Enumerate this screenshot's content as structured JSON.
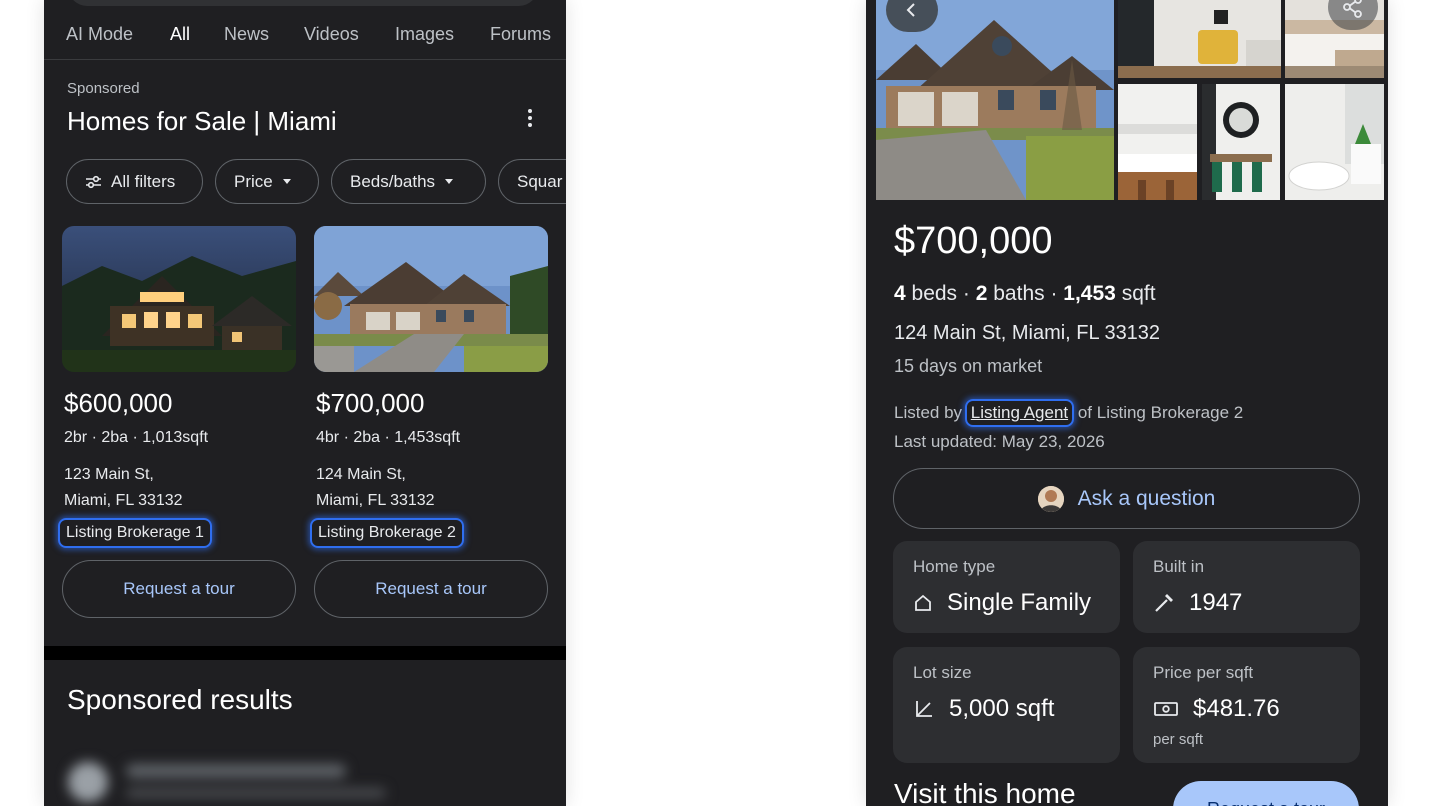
{
  "left_panel": {
    "tabs": [
      {
        "label": "AI Mode",
        "active": false
      },
      {
        "label": "All",
        "active": true
      },
      {
        "label": "News",
        "active": false
      },
      {
        "label": "Videos",
        "active": false
      },
      {
        "label": "Images",
        "active": false
      },
      {
        "label": "Forums",
        "active": false
      }
    ],
    "sponsored_label": "Sponsored",
    "section_title": "Homes for Sale | Miami",
    "filters": [
      {
        "label": "All filters",
        "icon": "tune-icon"
      },
      {
        "label": "Price",
        "icon": "caret-down-icon"
      },
      {
        "label": "Beds/baths",
        "icon": "caret-down-icon"
      },
      {
        "label": "Squar"
      }
    ],
    "listings": [
      {
        "price": "$600,000",
        "specs": "2br · 2ba · 1,013sqft",
        "address_line1": "123 Main St,",
        "address_line2": "Miami, FL 33132",
        "brokerage": "Listing Brokerage 1",
        "tour_label": "Request a tour"
      },
      {
        "price": "$700,000",
        "specs": "4br · 2ba · 1,453sqft",
        "address_line1": "124 Main St,",
        "address_line2": "Miami, FL 33132",
        "brokerage": "Listing Brokerage 2",
        "tour_label": "Request a tour"
      }
    ],
    "sponsored_results_title": "Sponsored results"
  },
  "right_panel": {
    "price": "$700,000",
    "beds_num": "4",
    "beds_label": " beds · ",
    "baths_num": "2",
    "baths_label": " baths · ",
    "sqft_num": "1,453",
    "sqft_label": " sqft",
    "address": "124 Main St, Miami, FL 33132",
    "days_on_market": "15 days on market",
    "listed_by_prefix": "Listed by ",
    "listing_agent": "Listing Agent",
    "listed_by_suffix": " of Listing Brokerage 2",
    "last_updated": "Last updated: May 23, 2026",
    "ask_question": "Ask a question",
    "facts": [
      {
        "label": "Home type",
        "value": "Single Family",
        "icon": "house-icon"
      },
      {
        "label": "Built in",
        "value": "1947",
        "icon": "hammer-icon"
      },
      {
        "label": "Lot size",
        "value": "5,000 sqft",
        "icon": "lot-size-icon"
      },
      {
        "label": "Price per sqft",
        "value": "$481.76",
        "sub": "per sqft",
        "icon": "cash-icon"
      }
    ],
    "visit_title": "Visit this home",
    "request_tour": "Request a tour"
  },
  "colors": {
    "background": "#1f1f22",
    "accent_link": "#a8c7fa",
    "highlight": "#2f6ef0",
    "card_surface": "#2d2e31"
  }
}
